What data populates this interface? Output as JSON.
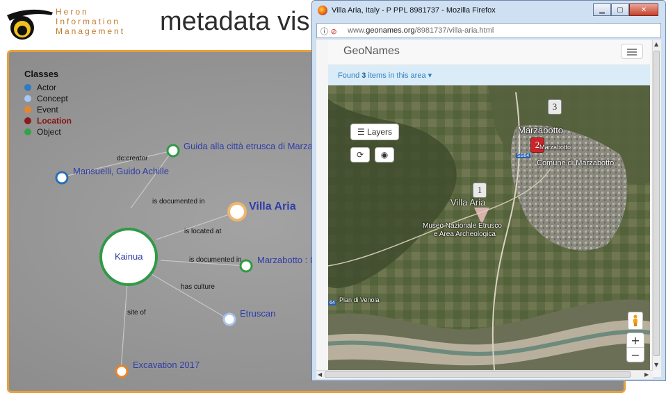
{
  "app": {
    "brand_lines": [
      "Heron",
      "Information",
      "Management"
    ],
    "title": "metadata vis"
  },
  "legend": {
    "title": "Classes",
    "items": [
      {
        "label": "Actor",
        "color": "#2f7ac4"
      },
      {
        "label": "Concept",
        "color": "#aac7ef"
      },
      {
        "label": "Event",
        "color": "#e8852a"
      },
      {
        "label": "Location",
        "color": "#8b1a1a"
      },
      {
        "label": "Object",
        "color": "#33a24a"
      }
    ]
  },
  "graph": {
    "center_node": "Kainua",
    "nodes": [
      {
        "label": "Guida alla città etrusca di Marzab",
        "type": "Object"
      },
      {
        "label": "Mansuelli, Guido Achille",
        "type": "Actor"
      },
      {
        "label": "Villa Aria",
        "type": "Location"
      },
      {
        "label": "Marzabotto : I",
        "type": "Object"
      },
      {
        "label": "Etruscan",
        "type": "Concept"
      },
      {
        "label": "Excavation 2017",
        "type": "Event"
      }
    ],
    "edges": [
      {
        "label": "dc:creator"
      },
      {
        "label": "is documented in"
      },
      {
        "label": "is located at"
      },
      {
        "label": "is documented in"
      },
      {
        "label": "has culture"
      },
      {
        "label": "site of"
      }
    ]
  },
  "browser": {
    "window_title": "Villa Aria, Italy - P PPL 8981737 - Mozilla Firefox",
    "url_prefix": "www.",
    "url_domain": "geonames.org",
    "url_path": "/8981737/villa-aria.html",
    "window_buttons": [
      "minimize",
      "maximize",
      "close"
    ]
  },
  "geonames": {
    "brand": "GeoNames",
    "found_prefix": "Found ",
    "found_count": "3",
    "found_suffix": " items in this area",
    "layers_label": "Layers",
    "markers": [
      "1",
      "2",
      "3"
    ],
    "map_labels": {
      "marzabotto": "Marzabotto",
      "marzabotto_small": "Marzabotto",
      "comune": "Comune di Marzabotto",
      "villa_aria": "Villa Aria",
      "museo_1": "Museo Nazionale Etrusco",
      "museo_2": "e Area Archeologica",
      "pian_di_venola": "Pian di Venola",
      "road_ss64": "SS64",
      "road_64": "64"
    },
    "zoom_in": "+",
    "zoom_out": "−"
  }
}
